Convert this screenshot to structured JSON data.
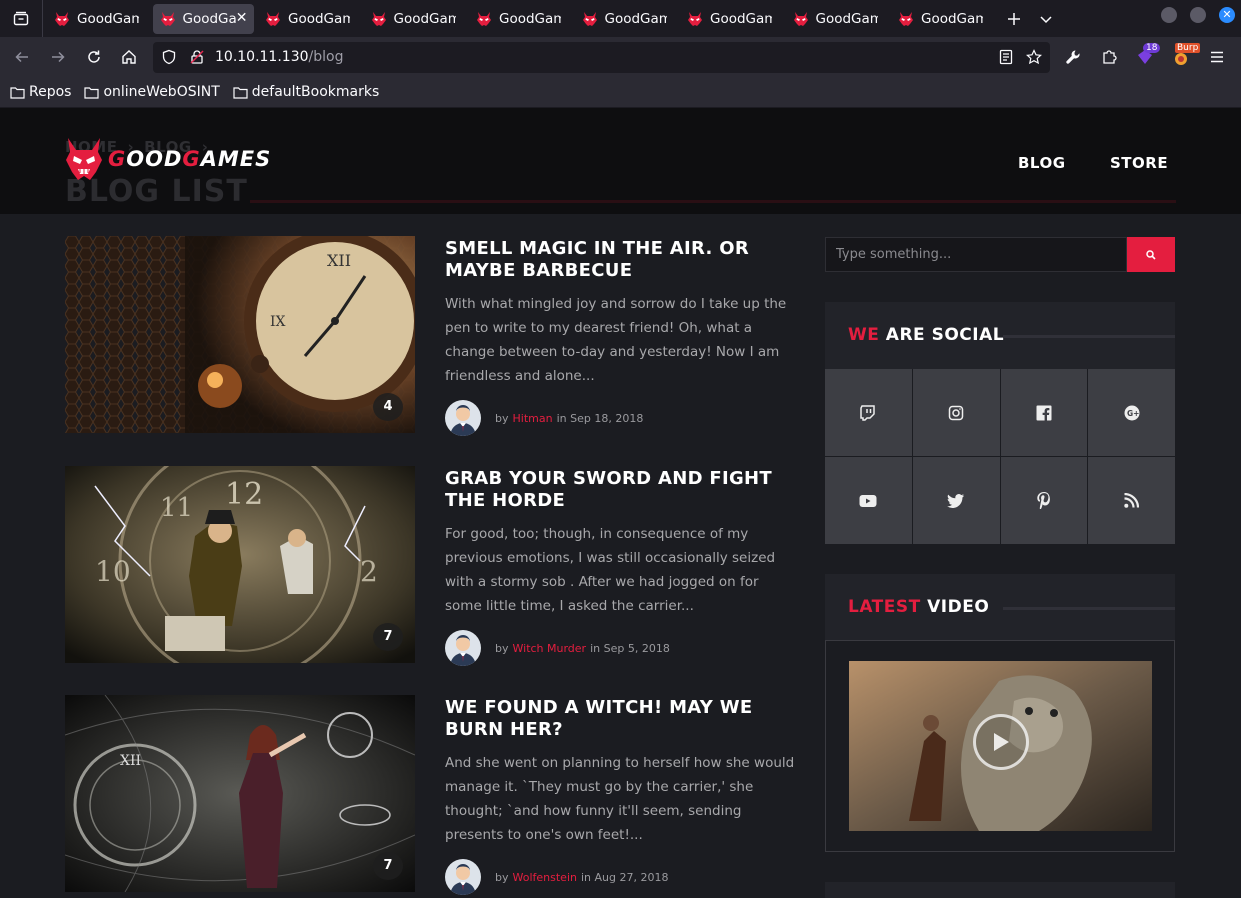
{
  "browser": {
    "tabs": [
      {
        "title": "GoodGam",
        "active": false
      },
      {
        "title": "GoodGa",
        "active": true
      },
      {
        "title": "GoodGam",
        "active": false
      },
      {
        "title": "GoodGam",
        "active": false
      },
      {
        "title": "GoodGam",
        "active": false
      },
      {
        "title": "GoodGam",
        "active": false
      },
      {
        "title": "GoodGam",
        "active": false
      },
      {
        "title": "GoodGam",
        "active": false
      },
      {
        "title": "GoodGam",
        "active": false
      }
    ],
    "url_host": "10.10.11.130",
    "url_path": "/blog",
    "extension_badge": "18",
    "burp_badge": "Burp",
    "bookmarks": [
      "Repos",
      "onlineWebOSINT",
      "defaultBookmarks"
    ]
  },
  "site": {
    "logo_prefix": "G",
    "logo_mid1": "OOD",
    "logo_g2": "G",
    "logo_rest": "AMES",
    "breadcrumb": [
      "HOME",
      "BLOG"
    ],
    "page_heading": "BLOG LIST",
    "nav": [
      "BLOG",
      "STORE"
    ]
  },
  "posts": [
    {
      "title": "SMELL MAGIC IN THE AIR. OR MAYBE BARBECUE",
      "excerpt": "With what mingled joy and sorrow do I take up the pen to write to my dearest friend! Oh, what a change between to-day and yesterday! Now I am friendless and alone...",
      "by": "by",
      "author": "Hitman",
      "in": "in",
      "date": "Sep 18, 2018",
      "comments": "4"
    },
    {
      "title": "GRAB YOUR SWORD AND FIGHT THE HORDE",
      "excerpt": "For good, too; though, in consequence of my previous emotions, I was still occasionally seized with a stormy sob . After we had jogged on for some little time, I asked the carrier...",
      "by": "by",
      "author": "Witch Murder",
      "in": "in",
      "date": "Sep 5, 2018",
      "comments": "7"
    },
    {
      "title": "WE FOUND A WITCH! MAY WE BURN HER?",
      "excerpt": "And she went on planning to herself how she would manage it. `They must go by the carrier,' she thought; `and how funny it'll seem, sending presents to one's own feet!...",
      "by": "by",
      "author": "Wolfenstein",
      "in": "in",
      "date": "Aug 27, 2018",
      "comments": "7"
    }
  ],
  "sidebar": {
    "search_placeholder": "Type something...",
    "social_title_accent": "WE",
    "social_title_rest": " ARE SOCIAL",
    "social_icons": [
      "twitch-icon",
      "instagram-icon",
      "facebook-icon",
      "google-plus-icon",
      "youtube-icon",
      "twitter-icon",
      "pinterest-icon",
      "rss-icon"
    ],
    "video_title_accent": "LATEST",
    "video_title_rest": " VIDEO"
  },
  "colors": {
    "accent": "#e41e3f",
    "bg": "#1b1c21",
    "header_bg": "#0e0e10"
  }
}
